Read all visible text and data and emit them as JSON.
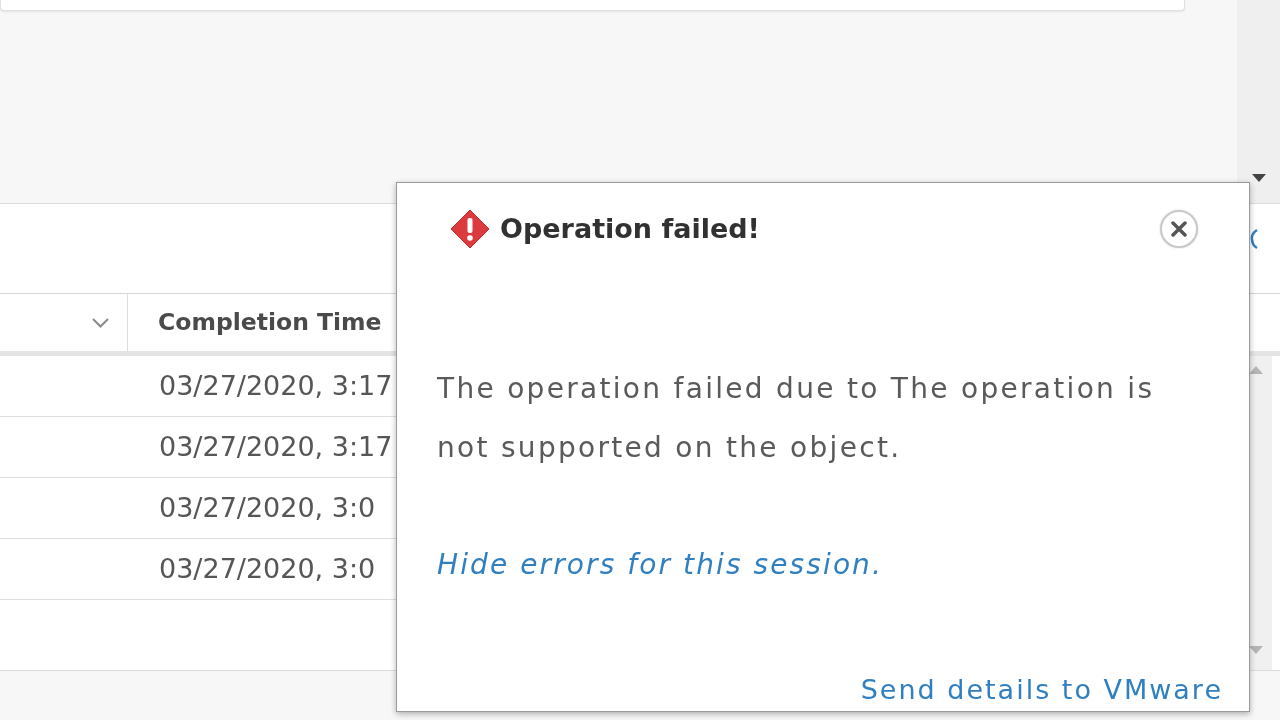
{
  "table": {
    "columns": [
      {
        "label": "Completion Time"
      }
    ],
    "rows": [
      {
        "completion_time": "03/27/2020, 3:17"
      },
      {
        "completion_time": "03/27/2020, 3:17"
      },
      {
        "completion_time": "03/27/2020, 3:0"
      },
      {
        "completion_time": "03/27/2020, 3:0"
      }
    ]
  },
  "error_dialog": {
    "title": "Operation failed!",
    "message": "The operation failed due to The operation is not supported on the object.",
    "hide_link": "Hide errors for this session.",
    "send_link": "Send details to VMware"
  }
}
